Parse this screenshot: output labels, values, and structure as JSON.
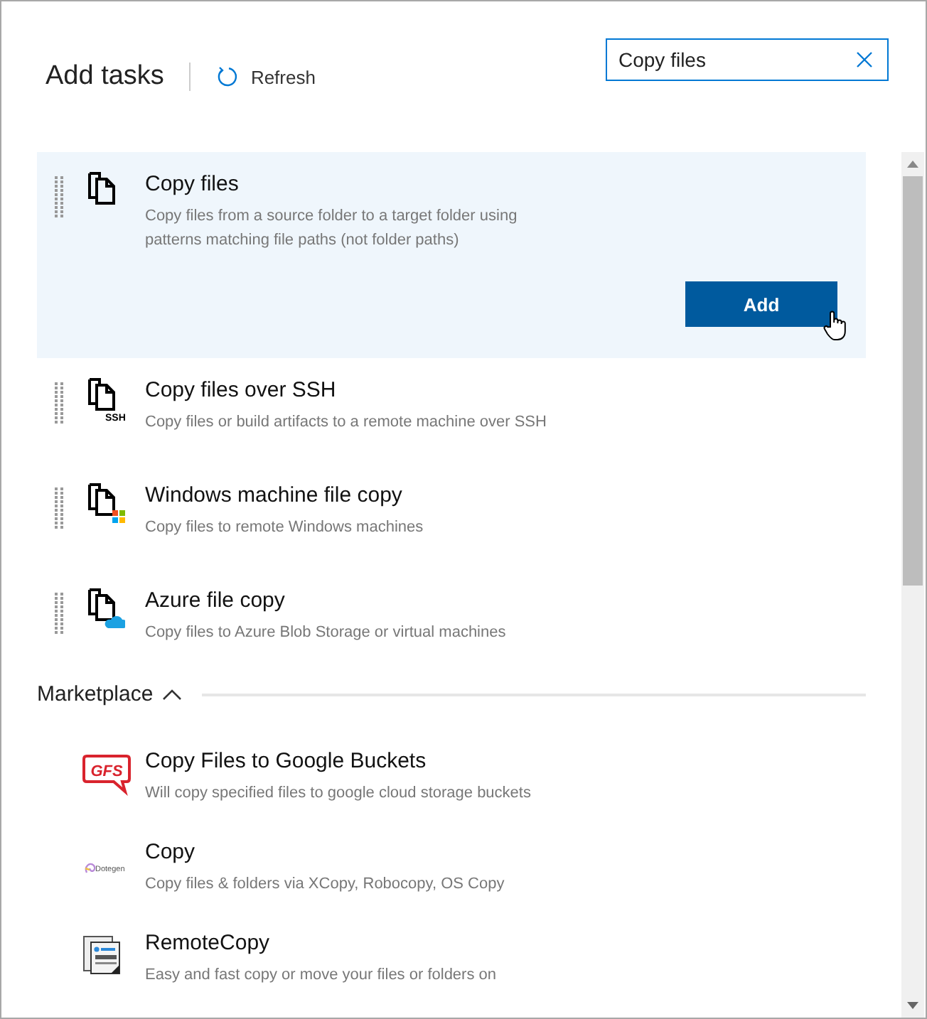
{
  "header": {
    "title": "Add tasks",
    "refresh_label": "Refresh"
  },
  "search": {
    "value": "Copy files"
  },
  "action_label": "Add",
  "tasks": [
    {
      "title": "Copy files",
      "description": "Copy files from a source folder to a target folder using patterns matching file paths (not folder paths)",
      "kind": "copy",
      "selected": true
    },
    {
      "title": "Copy files over SSH",
      "description": "Copy files or build artifacts to a remote machine over SSH",
      "kind": "ssh",
      "badge": "SSH",
      "selected": false
    },
    {
      "title": "Windows machine file copy",
      "description": "Copy files to remote Windows machines",
      "kind": "windows",
      "selected": false
    },
    {
      "title": "Azure file copy",
      "description": "Copy files to Azure Blob Storage or virtual machines",
      "kind": "azure",
      "selected": false
    }
  ],
  "marketplace": {
    "label": "Marketplace",
    "expanded": true,
    "items": [
      {
        "title": "Copy Files to Google Buckets",
        "description": "Will copy specified files to google cloud storage buckets",
        "kind": "gfs",
        "logo_text": "GFS"
      },
      {
        "title": "Copy",
        "description": "Copy files & folders via XCopy, Robocopy, OS Copy",
        "kind": "dotegen",
        "logo_text": "Dotegen"
      },
      {
        "title": "RemoteCopy",
        "description": "Easy and fast copy or move your files or folders on",
        "kind": "remote"
      }
    ]
  }
}
